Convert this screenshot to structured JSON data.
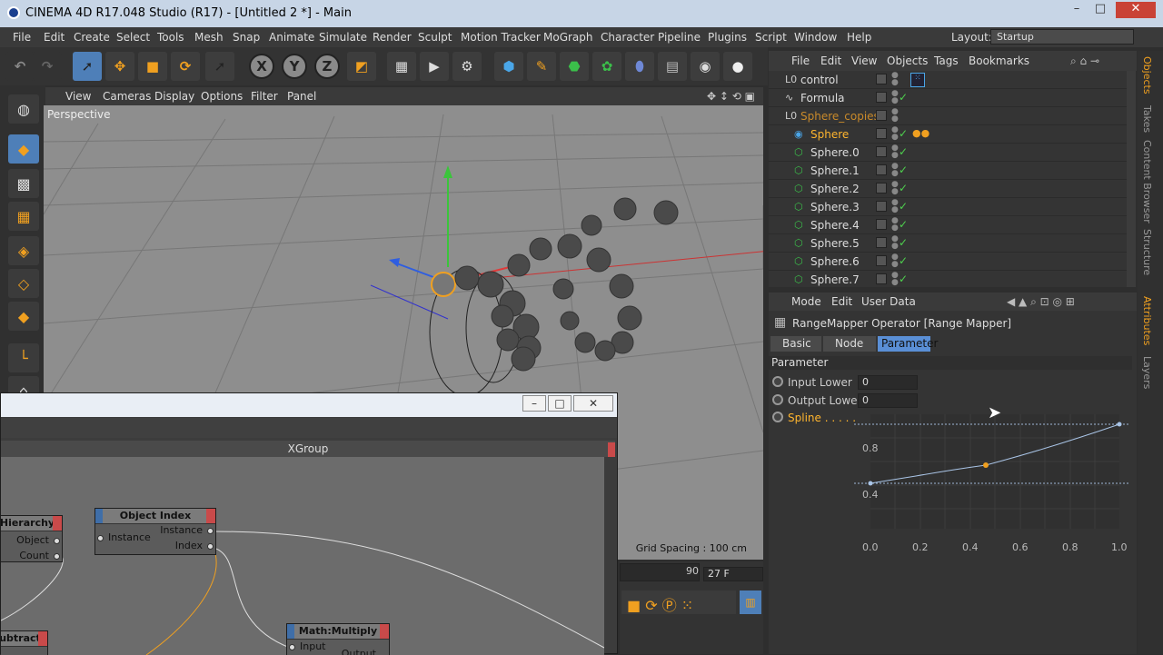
{
  "titlebar": {
    "title": "CINEMA 4D R17.048 Studio (R17) - [Untitled 2 *] - Main",
    "minimize": "–",
    "maximize": "□",
    "close": "✕"
  },
  "menubar": {
    "items": [
      "File",
      "Edit",
      "Create",
      "Select",
      "Tools",
      "Mesh",
      "Snap",
      "Animate",
      "Simulate",
      "Render",
      "Sculpt",
      "Motion Tracker",
      "MoGraph",
      "Character",
      "Pipeline",
      "Plugins",
      "Script",
      "Window",
      "Help"
    ],
    "layout_label": "Layout:",
    "layout_value": "Startup"
  },
  "toolbar": {
    "x": "X",
    "y": "Y",
    "z": "Z"
  },
  "viewport": {
    "menu": [
      "View",
      "Cameras",
      "Display",
      "Options",
      "Filter",
      "Panel"
    ],
    "label": "Perspective",
    "grid_spacing": "Grid Spacing : 100 cm"
  },
  "objects": {
    "menu": [
      "File",
      "Edit",
      "View",
      "Objects",
      "Tags",
      "Bookmarks"
    ],
    "rows": [
      {
        "name": "control",
        "style": "normal"
      },
      {
        "name": "Formula",
        "style": "normal"
      },
      {
        "name": "Sphere_copies",
        "style": "dim"
      },
      {
        "name": "Sphere",
        "style": "hl"
      },
      {
        "name": "Sphere.0",
        "style": "normal"
      },
      {
        "name": "Sphere.1",
        "style": "normal"
      },
      {
        "name": "Sphere.2",
        "style": "normal"
      },
      {
        "name": "Sphere.3",
        "style": "normal"
      },
      {
        "name": "Sphere.4",
        "style": "normal"
      },
      {
        "name": "Sphere.5",
        "style": "normal"
      },
      {
        "name": "Sphere.6",
        "style": "normal"
      },
      {
        "name": "Sphere.7",
        "style": "normal"
      }
    ]
  },
  "sidetabs": [
    "Objects",
    "Takes",
    "Content Browser",
    "Structure",
    "Attributes",
    "Layers"
  ],
  "attributes": {
    "menu": [
      "Mode",
      "Edit",
      "User Data"
    ],
    "title": "RangeMapper Operator [Range Mapper]",
    "tabs": [
      "Basic",
      "Node",
      "Parameter"
    ],
    "section": "Parameter",
    "input_lower_label": "Input Lower",
    "input_lower_value": "0",
    "output_lower_label": "Output Lower",
    "output_lower_value": "0",
    "spline_label": "Spline . . . . .",
    "spline_x_ticks": [
      "0.0",
      "0.2",
      "0.4",
      "0.6",
      "0.8",
      "1.0"
    ],
    "spline_y_ticks": [
      "0.8",
      "0.4"
    ]
  },
  "xpresso": {
    "header": "XGroup",
    "nodes": {
      "hierarchy": {
        "title": "Hierarchy",
        "ports": [
          "Object",
          "Count"
        ]
      },
      "object_index": {
        "title": "Object Index",
        "in": "Instance",
        "out": [
          "Instance",
          "Index"
        ]
      },
      "math_multiply": {
        "title": "Math:Multiply",
        "in": "Input",
        "out": "Output"
      },
      "subtract": {
        "title": "ubtract"
      }
    }
  },
  "timeline": {
    "mark": "90",
    "frame": "27 F"
  }
}
